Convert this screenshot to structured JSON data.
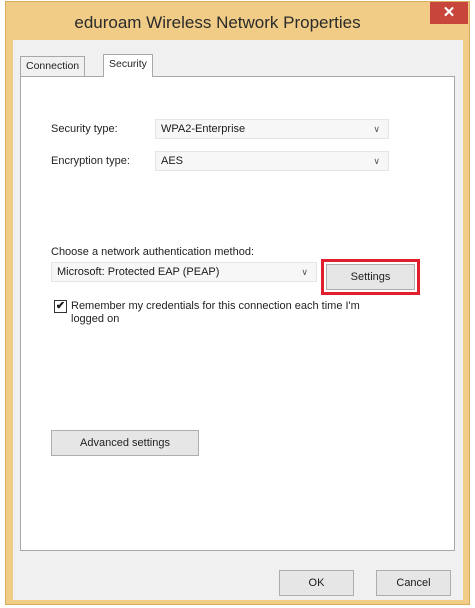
{
  "window": {
    "title": "eduroam Wireless Network Properties",
    "close_glyph": "✕"
  },
  "tabs": [
    {
      "label": "Connection",
      "selected": false
    },
    {
      "label": "Security",
      "selected": true
    }
  ],
  "security": {
    "security_type_label": "Security type:",
    "security_type_value": "WPA2-Enterprise",
    "encryption_type_label": "Encryption type:",
    "encryption_type_value": "AES",
    "auth_method_label": "Choose a network authentication method:",
    "auth_method_value": "Microsoft: Protected EAP (PEAP)",
    "settings_button": "Settings",
    "remember_checkbox_checked": true,
    "remember_checkbox_label": "Remember my credentials for this connection each time I'm logged on",
    "advanced_button": "Advanced settings"
  },
  "footer": {
    "ok_button": "OK",
    "cancel_button": "Cancel"
  },
  "icons": {
    "dropdown_chevron": "∨",
    "checkmark": "✔"
  },
  "colors": {
    "title_bar": "#f0cc86",
    "close_button": "#c7453b",
    "highlight_box": "#e01e2d"
  }
}
